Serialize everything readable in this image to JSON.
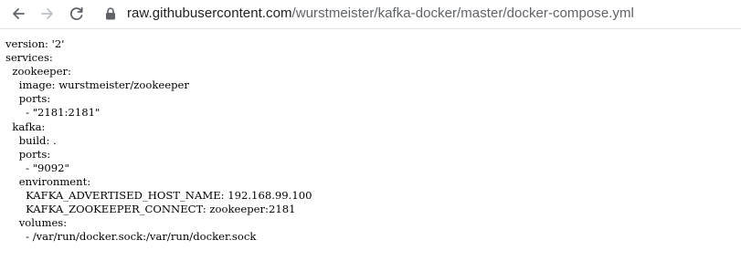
{
  "browser": {
    "url_host": "raw.githubusercontent.com",
    "url_path": "/wurstmeister/kafka-docker/master/docker-compose.yml",
    "icons": {
      "back": "arrow-left-icon",
      "forward": "arrow-right-icon",
      "reload": "reload-icon",
      "secure": "lock-icon"
    }
  },
  "file": {
    "lines": [
      "version: '2'",
      "services:",
      "  zookeeper:",
      "    image: wurstmeister/zookeeper",
      "    ports:",
      "      - \"2181:2181\"",
      "  kafka:",
      "    build: .",
      "    ports:",
      "      - \"9092\"",
      "    environment:",
      "      KAFKA_ADVERTISED_HOST_NAME: 192.168.99.100",
      "      KAFKA_ZOOKEEPER_CONNECT: zookeeper:2181",
      "    volumes:",
      "      - /var/run/docker.sock:/var/run/docker.sock"
    ]
  }
}
